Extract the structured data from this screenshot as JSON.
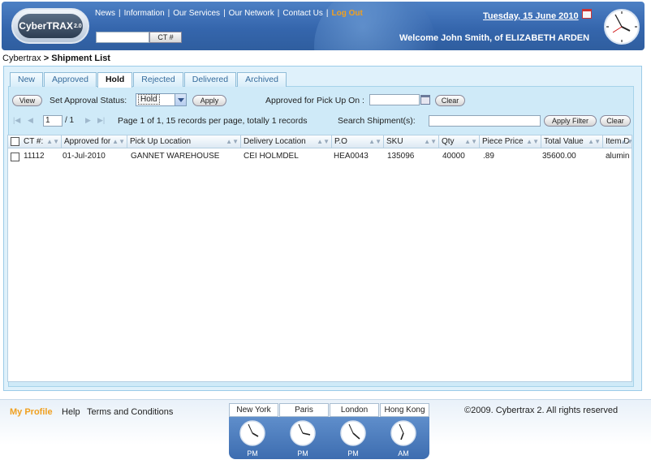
{
  "header": {
    "logo_text": "CyberTRAX",
    "logo_version": "2.0",
    "nav": [
      {
        "label": "News"
      },
      {
        "label": "Information"
      },
      {
        "label": "Our Services"
      },
      {
        "label": "Our Network"
      },
      {
        "label": "Contact Us"
      }
    ],
    "logout_label": "Log Out",
    "ct_button_label": "CT #",
    "search_value": "",
    "date": "Tuesday, 15 June 2010",
    "welcome": "Welcome John Smith, of ELIZABETH ARDEN"
  },
  "breadcrumb": {
    "root": "Cybertrax",
    "separator": ">",
    "current": "Shipment List"
  },
  "tabs": [
    {
      "label": "New",
      "active": false
    },
    {
      "label": "Approved",
      "active": false
    },
    {
      "label": "Hold",
      "active": true
    },
    {
      "label": "Rejected",
      "active": false
    },
    {
      "label": "Delivered",
      "active": false
    },
    {
      "label": "Archived",
      "active": false
    }
  ],
  "toolbar": {
    "view_label": "View",
    "set_status_label": "Set Approval Status:",
    "status_value": "Hold",
    "apply_label": "Apply",
    "approved_for_label": "Approved for Pick Up On :",
    "approved_for_value": "",
    "clear_label": "Clear"
  },
  "pager": {
    "page_value": "1",
    "page_total": "/ 1",
    "summary": "Page 1 of 1, 15 records per page, totally 1 records",
    "search_label": "Search Shipment(s):",
    "search_value": "",
    "apply_filter_label": "Apply Filter",
    "clear_label": "Clear"
  },
  "grid": {
    "columns": [
      "CT #",
      "Approved for",
      "Pick Up Location",
      "Delivery Location",
      "P.O",
      "SKU",
      "Qty",
      "Piece Price",
      "Total Value",
      "Item D"
    ],
    "rows": [
      [
        "11112",
        "01-Jul-2010",
        "GANNET WAREHOUSE",
        "CEI HOLMDEL",
        "HEA0043",
        "135096",
        "40000",
        ".89",
        "35600.00",
        "alumin"
      ]
    ]
  },
  "footer": {
    "my_profile": "My Profile",
    "help": "Help",
    "terms": "Terms and Conditions",
    "copyright": "©2009. Cybertrax 2. All rights reserved",
    "clocks": [
      {
        "city": "New York",
        "ampm": "PM"
      },
      {
        "city": "Paris",
        "ampm": "PM"
      },
      {
        "city": "London",
        "ampm": "PM"
      },
      {
        "city": "Hong Kong",
        "ampm": "AM"
      }
    ]
  },
  "colors": {
    "header_blue": "#3566ad",
    "accent_orange": "#f0a020",
    "panel_bg": "#cfeaf8",
    "tab_text": "#356b9c"
  }
}
